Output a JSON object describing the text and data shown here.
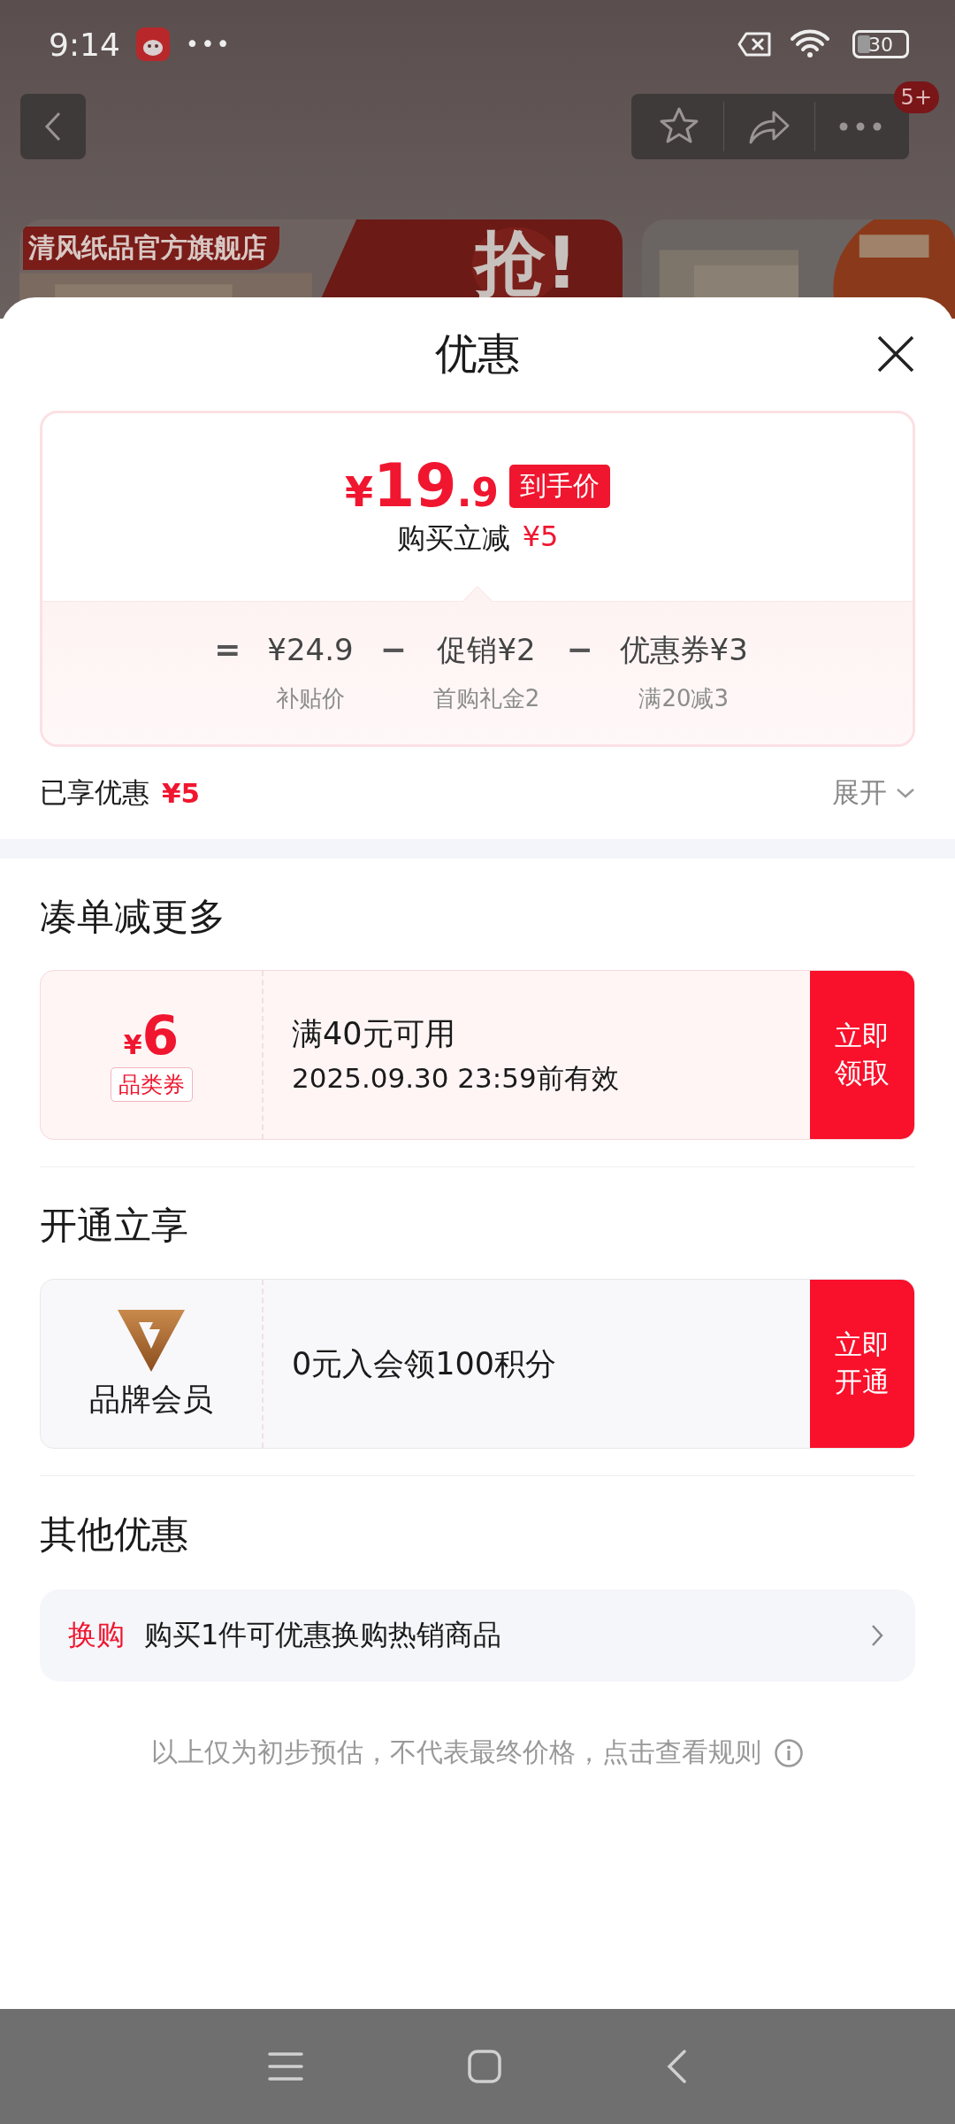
{
  "status_bar": {
    "time": "9:14",
    "overflow": "•••",
    "battery": "30"
  },
  "nav": {
    "badge": "5+"
  },
  "banners": {
    "store_name": "清风纸品官方旗舰店",
    "slogan": "抢!"
  },
  "sheet": {
    "title": "优惠",
    "price_card": {
      "currency": "¥",
      "price_int": "19",
      "price_dec": ".9",
      "price_tag": "到手价",
      "instant_label": "购买立减",
      "instant_amount": "¥5",
      "breakdown": [
        {
          "operator": "=",
          "value": "¥24.9",
          "caption": "补贴价"
        },
        {
          "operator": "−",
          "label": "促销",
          "value": "¥2",
          "caption": "首购礼金2"
        },
        {
          "operator": "−",
          "label": "优惠券",
          "value": "¥3",
          "caption": "满20减3"
        }
      ]
    },
    "savings": {
      "label": "已享优惠",
      "amount": "¥5",
      "expand": "展开"
    },
    "sections": [
      {
        "kind": "coupon",
        "title": "凑单减更多",
        "currency": "¥",
        "amount": "6",
        "tag": "品类券",
        "condition": "满40元可用",
        "validity": "2025.09.30 23:59前有效",
        "action": "立即领取"
      },
      {
        "kind": "membership",
        "title": "开通立享",
        "brand_label": "品牌会员",
        "offer": "0元入会领100积分",
        "action": "立即开通"
      },
      {
        "kind": "other",
        "title": "其他优惠",
        "items": [
          {
            "tag": "换购",
            "text": "购买1件可优惠换购热销商品"
          }
        ]
      }
    ],
    "footer_note": "以上仅为初步预估，不代表最终价格，点击查看规则"
  }
}
